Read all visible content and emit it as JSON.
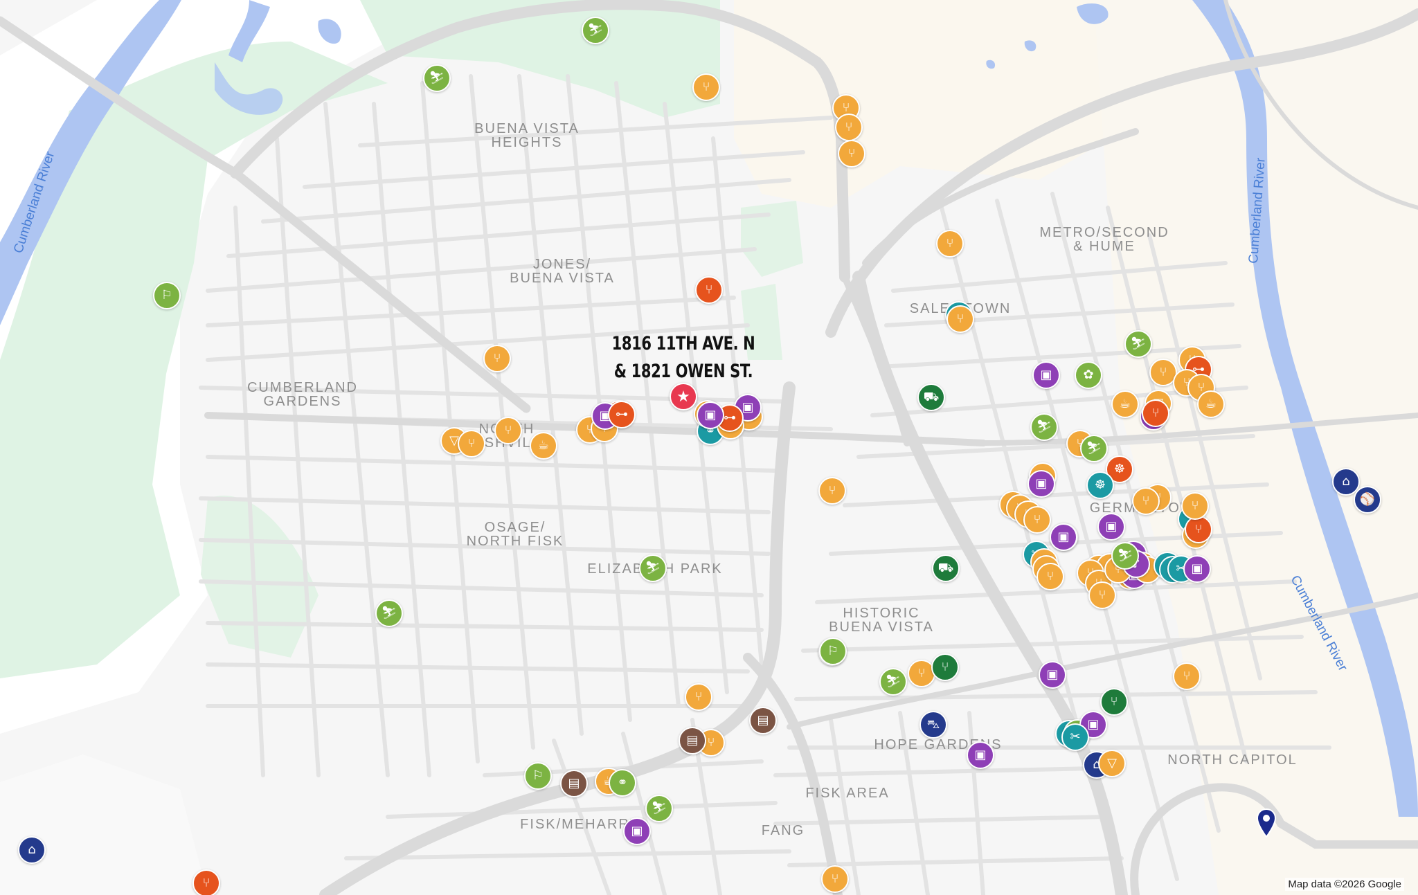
{
  "map": {
    "property_title_line1": "1816 11TH AVE. N",
    "property_title_line2": "& 1821 OWEN ST.",
    "attribution": "Map data ©2026 Google",
    "colors": {
      "food": "#f2a83b",
      "shop": "#8e3fb6",
      "park": "#7cb342",
      "fitness": "#e6531d",
      "teal": "#1b9aa3",
      "grocery": "#1e7b3b",
      "transit": "#243a8c",
      "library": "#7b5444",
      "highlight": "#e8384f",
      "water": "#aec5f2",
      "greenspace": "#dff3e4"
    },
    "rivers": [
      {
        "label": "Cumberland River"
      },
      {
        "label": "Cumberland River"
      },
      {
        "label": "Cumberland River"
      }
    ],
    "neighborhoods": [
      {
        "line1": "BUENA VISTA",
        "line2": "HEIGHTS"
      },
      {
        "line1": "JONES/",
        "line2": "BUENA VISTA"
      },
      {
        "line1": "CUMBERLAND",
        "line2": "GARDENS"
      },
      {
        "line1": "NORTH",
        "line2": "NASHVILLE"
      },
      {
        "line1": "OSAGE/",
        "line2": "NORTH FISK"
      },
      {
        "line1": "ELIZABETH PARK",
        "line2": ""
      },
      {
        "line1": "METRO/SECOND",
        "line2": "& HUME"
      },
      {
        "line1": "SALEMTOWN",
        "line2": ""
      },
      {
        "line1": "GERMANTOWN",
        "line2": ""
      },
      {
        "line1": "HISTORIC",
        "line2": "BUENA VISTA"
      },
      {
        "line1": "HOPE GARDENS",
        "line2": ""
      },
      {
        "line1": "NORTH CAPITOL",
        "line2": ""
      },
      {
        "line1": "FISK AREA",
        "line2": ""
      },
      {
        "line1": "FANG",
        "line2": ""
      },
      {
        "line1": "FISK/MEHARRY",
        "line2": ""
      }
    ],
    "pois": [
      {
        "type": "park",
        "icon": "hiking-icon"
      },
      {
        "type": "park",
        "icon": "hiking-icon"
      },
      {
        "type": "park",
        "icon": "golf-icon"
      },
      {
        "type": "food",
        "icon": "restaurant-icon"
      },
      {
        "type": "food",
        "icon": "restaurant-icon"
      },
      {
        "type": "food",
        "icon": "restaurant-icon"
      },
      {
        "type": "food",
        "icon": "restaurant-icon"
      },
      {
        "type": "fitness",
        "icon": "restaurant-icon"
      },
      {
        "type": "food",
        "icon": "restaurant-icon"
      },
      {
        "type": "fitness",
        "icon": "dumbbell-icon"
      },
      {
        "type": "food",
        "icon": "restaurant-icon"
      },
      {
        "type": "food",
        "icon": "bar-icon"
      },
      {
        "type": "food",
        "icon": "restaurant-icon"
      },
      {
        "type": "food",
        "icon": "restaurant-icon"
      },
      {
        "type": "food",
        "icon": "coffee-icon"
      },
      {
        "type": "food",
        "icon": "restaurant-icon"
      },
      {
        "type": "food",
        "icon": "restaurant-icon"
      },
      {
        "type": "shop",
        "icon": "shopping-bag-icon"
      },
      {
        "type": "fitness",
        "icon": "dumbbell-icon"
      },
      {
        "type": "shop",
        "icon": "shopping-bag-icon"
      },
      {
        "type": "teal",
        "icon": "bike-icon"
      },
      {
        "type": "food",
        "icon": "restaurant-icon"
      },
      {
        "type": "food",
        "icon": "restaurant-icon"
      },
      {
        "type": "fitness",
        "icon": "dumbbell-icon"
      },
      {
        "type": "shop",
        "icon": "shopping-bag-icon"
      },
      {
        "type": "food",
        "icon": "restaurant-icon"
      },
      {
        "type": "park",
        "icon": "hiking-icon"
      },
      {
        "type": "park",
        "icon": "hiking-icon"
      },
      {
        "type": "park",
        "icon": "golf-icon"
      },
      {
        "type": "park",
        "icon": "golf-icon"
      },
      {
        "type": "food",
        "icon": "restaurant-icon"
      },
      {
        "type": "teal",
        "icon": "restaurant-icon"
      },
      {
        "type": "food",
        "icon": "restaurant-icon"
      },
      {
        "type": "grocery",
        "icon": "cart-icon"
      },
      {
        "type": "grocery",
        "icon": "cart-icon"
      },
      {
        "type": "food",
        "icon": "restaurant-icon"
      },
      {
        "type": "shop",
        "icon": "shopping-bag-icon"
      },
      {
        "type": "park",
        "icon": "paw-icon"
      },
      {
        "type": "park",
        "icon": "hiking-icon"
      },
      {
        "type": "food",
        "icon": "restaurant-icon"
      },
      {
        "type": "fitness",
        "icon": "dumbbell-icon"
      },
      {
        "type": "food",
        "icon": "restaurant-icon"
      },
      {
        "type": "food",
        "icon": "restaurant-icon"
      },
      {
        "type": "food",
        "icon": "coffee-icon"
      },
      {
        "type": "food",
        "icon": "coffee-icon"
      },
      {
        "type": "food",
        "icon": "bar-icon"
      },
      {
        "type": "shop",
        "icon": "shopping-bag-icon"
      },
      {
        "type": "fitness",
        "icon": "restaurant-icon"
      },
      {
        "type": "park",
        "icon": "hiking-icon"
      },
      {
        "type": "food",
        "icon": "restaurant-icon"
      },
      {
        "type": "fitness",
        "icon": "yoga-icon"
      },
      {
        "type": "teal",
        "icon": "yoga-icon"
      },
      {
        "type": "food",
        "icon": "restaurant-icon"
      },
      {
        "type": "shop",
        "icon": "shopping-bag-icon"
      },
      {
        "type": "food",
        "icon": "restaurant-icon"
      },
      {
        "type": "food",
        "icon": "restaurant-icon"
      },
      {
        "type": "food",
        "icon": "restaurant-icon"
      },
      {
        "type": "food",
        "icon": "restaurant-icon"
      },
      {
        "type": "food",
        "icon": "restaurant-icon"
      },
      {
        "type": "food",
        "icon": "restaurant-icon"
      },
      {
        "type": "teal",
        "icon": "restaurant-icon"
      },
      {
        "type": "food",
        "icon": "restaurant-icon"
      },
      {
        "type": "fitness",
        "icon": "restaurant-icon"
      },
      {
        "type": "food",
        "icon": "restaurant-icon"
      },
      {
        "type": "food",
        "icon": "restaurant-icon"
      },
      {
        "type": "shop",
        "icon": "shopping-bag-icon"
      },
      {
        "type": "teal",
        "icon": "scissors-icon"
      },
      {
        "type": "food",
        "icon": "restaurant-icon"
      },
      {
        "type": "food",
        "icon": "restaurant-icon"
      },
      {
        "type": "food",
        "icon": "restaurant-icon"
      },
      {
        "type": "food",
        "icon": "restaurant-icon"
      },
      {
        "type": "shop",
        "icon": "shopping-bag-icon"
      },
      {
        "type": "food",
        "icon": "restaurant-icon"
      },
      {
        "type": "shop",
        "icon": "shopping-bag-icon"
      },
      {
        "type": "shop",
        "icon": "shopping-bag-icon"
      },
      {
        "type": "food",
        "icon": "restaurant-icon"
      },
      {
        "type": "food",
        "icon": "restaurant-icon"
      },
      {
        "type": "shop",
        "icon": "shopping-bag-icon"
      },
      {
        "type": "food",
        "icon": "restaurant-icon"
      },
      {
        "type": "food",
        "icon": "restaurant-icon"
      },
      {
        "type": "food",
        "icon": "restaurant-icon"
      },
      {
        "type": "food",
        "icon": "restaurant-icon"
      },
      {
        "type": "food",
        "icon": "restaurant-icon"
      },
      {
        "type": "food",
        "icon": "restaurant-icon"
      },
      {
        "type": "teal",
        "icon": "checkered-flag-icon"
      },
      {
        "type": "shop",
        "icon": "music-icon"
      },
      {
        "type": "park",
        "icon": "hiking-icon"
      },
      {
        "type": "teal",
        "icon": "scissors-icon"
      },
      {
        "type": "teal",
        "icon": "scissors-icon"
      },
      {
        "type": "shop",
        "icon": "shopping-bag-icon"
      },
      {
        "type": "transit",
        "icon": "museum-icon"
      },
      {
        "type": "transit",
        "icon": "baseball-icon"
      },
      {
        "type": "park",
        "icon": "hiking-icon"
      },
      {
        "type": "park",
        "icon": "hiking-icon"
      },
      {
        "type": "food",
        "icon": "restaurant-icon"
      },
      {
        "type": "grocery",
        "icon": "restaurant-icon"
      },
      {
        "type": "shop",
        "icon": "shopping-bag-icon"
      },
      {
        "type": "food",
        "icon": "restaurant-icon"
      },
      {
        "type": "grocery",
        "icon": "restaurant-icon"
      },
      {
        "type": "transit",
        "icon": "car-icon"
      },
      {
        "type": "shop",
        "icon": "shopping-bag-icon"
      },
      {
        "type": "teal",
        "icon": "restaurant-icon"
      },
      {
        "type": "park",
        "icon": "hiking-icon"
      },
      {
        "type": "shop",
        "icon": "shopping-bag-icon"
      },
      {
        "type": "transit",
        "icon": "museum-icon"
      },
      {
        "type": "food",
        "icon": "bar-icon"
      },
      {
        "type": "teal",
        "icon": "scissors-icon"
      },
      {
        "type": "food",
        "icon": "restaurant-icon"
      },
      {
        "type": "food",
        "icon": "restaurant-icon"
      },
      {
        "type": "library",
        "icon": "book-icon"
      },
      {
        "type": "library",
        "icon": "book-icon"
      },
      {
        "type": "library",
        "icon": "book-icon"
      },
      {
        "type": "park",
        "icon": "golf-icon"
      },
      {
        "type": "food",
        "icon": "coffee-icon"
      },
      {
        "type": "park",
        "icon": "bike-icon"
      },
      {
        "type": "transit",
        "icon": "museum-icon"
      },
      {
        "type": "park",
        "icon": "hiking-icon"
      },
      {
        "type": "shop",
        "icon": "shopping-bag-icon"
      },
      {
        "type": "fitness",
        "icon": "restaurant-icon"
      },
      {
        "type": "food",
        "icon": "restaurant-icon"
      }
    ]
  }
}
